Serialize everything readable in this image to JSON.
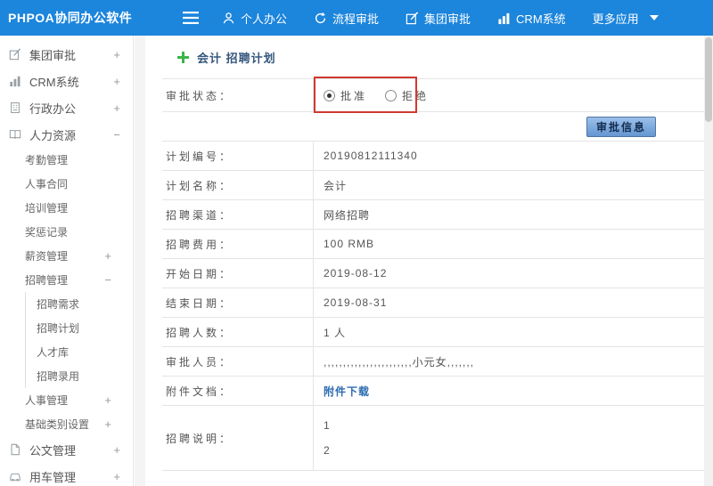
{
  "colors": {
    "header_blue": "#1c85dc",
    "link_blue": "#2d6cb0",
    "annotation_red": "#cf3a30",
    "button_blue": "#6496d2",
    "plus_green": "#3bb54a"
  },
  "header": {
    "logo": "PHPOA协同办公软件",
    "nav": [
      {
        "label": "个人办公",
        "icon": "person-icon"
      },
      {
        "label": "流程审批",
        "icon": "cycle-icon"
      },
      {
        "label": "集团审批",
        "icon": "edit-icon"
      },
      {
        "label": "CRM系统",
        "icon": "bar-chart-icon"
      },
      {
        "label": "更多应用",
        "icon": "caret-down-icon"
      }
    ]
  },
  "sidebar": {
    "items": [
      {
        "label": "集团审批",
        "toggle": "+"
      },
      {
        "label": "CRM系统",
        "toggle": "+"
      },
      {
        "label": "行政办公",
        "toggle": "+"
      },
      {
        "label": "人力资源",
        "toggle": "−"
      },
      {
        "label": "考勤管理",
        "toggle": ""
      },
      {
        "label": "人事合同",
        "toggle": ""
      },
      {
        "label": "培训管理",
        "toggle": ""
      },
      {
        "label": "奖惩记录",
        "toggle": ""
      },
      {
        "label": "薪资管理",
        "toggle": "+"
      },
      {
        "label": "招聘管理",
        "toggle": "−"
      },
      {
        "label": "招聘需求",
        "toggle": ""
      },
      {
        "label": "招聘计划",
        "toggle": ""
      },
      {
        "label": "人才库",
        "toggle": ""
      },
      {
        "label": "招聘录用",
        "toggle": ""
      },
      {
        "label": "人事管理",
        "toggle": "+"
      },
      {
        "label": "基础类别设置",
        "toggle": "+"
      },
      {
        "label": "公文管理",
        "toggle": "+"
      },
      {
        "label": "用车管理",
        "toggle": "+"
      }
    ]
  },
  "main": {
    "title": "会计 招聘计划",
    "status": {
      "label": "审批状态：",
      "options": [
        {
          "label": "批准",
          "checked": true
        },
        {
          "label": "拒绝",
          "checked": false
        }
      ]
    },
    "approve_button": "审批信息",
    "rows": [
      {
        "label": "计划编号：",
        "value": "20190812111340"
      },
      {
        "label": "计划名称：",
        "value": "会计"
      },
      {
        "label": "招聘渠道：",
        "value": "网络招聘"
      },
      {
        "label": "招聘费用：",
        "value": "100 RMB"
      },
      {
        "label": "开始日期：",
        "value": "2019-08-12"
      },
      {
        "label": "结束日期：",
        "value": "2019-08-31"
      },
      {
        "label": "招聘人数：",
        "value": "1 人"
      },
      {
        "label": "审批人员：",
        "value": ",,,,,,,,,,,,,,,,,,,,,,,小元女,,,,,,,"
      },
      {
        "label": "附件文档：",
        "value": "附件下载"
      },
      {
        "label": "招聘说明：",
        "lines": [
          "1",
          "2"
        ]
      }
    ]
  }
}
